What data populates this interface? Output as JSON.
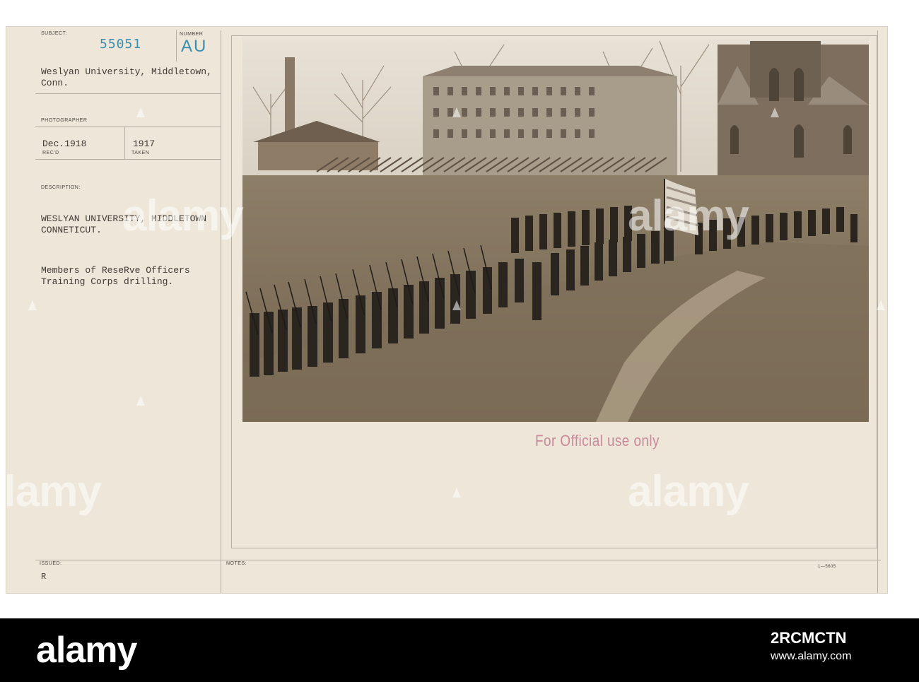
{
  "card": {
    "subject_label": "SUBJECT:",
    "number_label": "NUMBER",
    "subject_number": "55051",
    "number_code": "AU",
    "subject_line1": "Weslyan University, Middletown,",
    "subject_line2": "Conn.",
    "photographer_label": "PHOTOGRAPHER",
    "received_date": "Dec.1918",
    "received_label": "REC'D",
    "taken_date": "1917",
    "taken_label": "TAKEN",
    "description_label": "DESCRIPTION:",
    "description_line1": "WESLYAN UNIVERSITY, MIDDLETOWN",
    "description_line2": "CONNETICUT.",
    "description_line3": "Members of ReseRve Officers",
    "description_line4": "Training Corps drilling.",
    "issued_label": "ISSUED:",
    "issued_value": "R",
    "notes_label": "NOTES:",
    "form_code": "1—5605"
  },
  "stamp": {
    "official_text": "For Official use only",
    "official_color": "#c8899a"
  },
  "watermark": {
    "text": "alamy"
  },
  "footer": {
    "logo": "alamy",
    "image_id": "2RCMCTN",
    "url": "www.alamy.com"
  }
}
